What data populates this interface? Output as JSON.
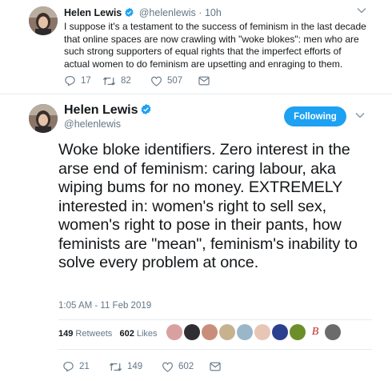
{
  "tweet1": {
    "name": "Helen Lewis",
    "handle": "@helenlewis",
    "separator": "·",
    "time": "10h",
    "text": "I suppose it's a testament to the success of feminism in the last decade that online spaces are now crawling with \"woke blokes\": men who are such strong supporters of equal rights that the imperfect efforts of actual women to do feminism are upsetting and enraging to them.",
    "replies": "17",
    "retweets": "82",
    "likes": "507"
  },
  "tweet2": {
    "name": "Helen Lewis",
    "handle": "@helenlewis",
    "follow_label": "Following",
    "text": "Woke bloke identifiers. Zero interest in the arse end of feminism: caring labour, aka wiping bums for no money. EXTREMELY interested in: women's right to sell sex, women's right to pose in their pants, how feminists are \"mean\", feminism's inability to solve every problem at once.",
    "timestamp": "1:05 AM - 11 Feb 2019",
    "retweet_count": "149",
    "retweet_label": "Retweets",
    "like_count": "602",
    "like_label": "Likes",
    "liker_b": "B",
    "replies": "21",
    "retweets": "149",
    "likes": "602"
  },
  "colors": {
    "accent": "#1da1f2",
    "muted": "#657786",
    "text": "#14171a"
  }
}
